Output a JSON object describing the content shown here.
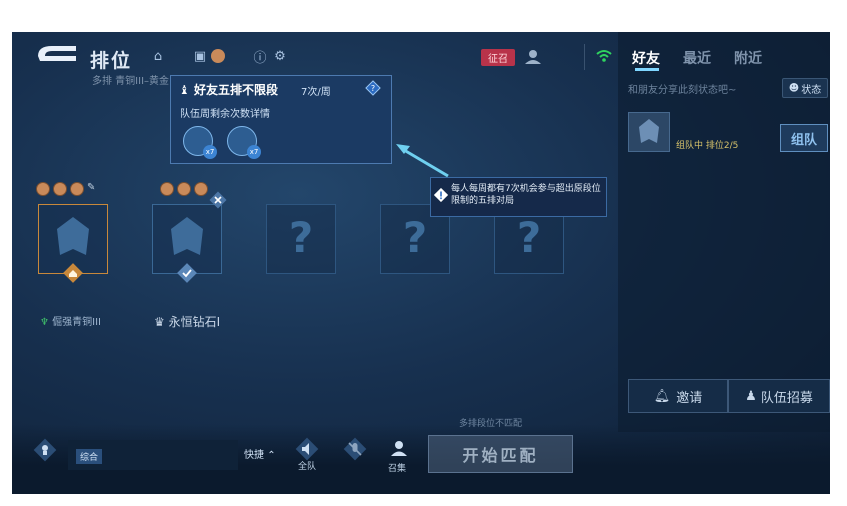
{
  "header": {
    "title": "排位",
    "subtitle": "多排 青铜III–黄金",
    "challenge_badge": "征召"
  },
  "right_panel": {
    "tabs": [
      {
        "label": "好友",
        "active": true
      },
      {
        "label": "最近",
        "active": false
      },
      {
        "label": "附近",
        "active": false
      }
    ],
    "share_status": "和朋友分享此刻状态吧~",
    "status_button": "状态",
    "friend_status": "组队中 排位2/5",
    "team_button": "组队",
    "invite_button": "邀请",
    "recruit_button": "队伍招募"
  },
  "popup": {
    "title": "好友五排不限段",
    "weekly": "7次/周",
    "subtitle": "队伍周剩余次数详情",
    "tokens": [
      {
        "count": "x7"
      },
      {
        "count": "x7"
      }
    ]
  },
  "hint": {
    "text": "每人每周都有7次机会参与超出原段位限制的五排对局"
  },
  "slots": [
    {
      "type": "player",
      "rank": "倔强青铜III"
    },
    {
      "type": "player",
      "rank": "永恒钻石I"
    },
    {
      "type": "empty",
      "mark": "?"
    },
    {
      "type": "empty",
      "mark": "?"
    },
    {
      "type": "empty",
      "mark": "?"
    }
  ],
  "bottom_bar": {
    "chat_tag": "综合",
    "quick_button": "快捷",
    "all_team_label": "全队",
    "summon_label": "召集",
    "mismatch_text": "多排段位不匹配",
    "start_button": "开始匹配"
  },
  "colors": {
    "background": "#17304f",
    "accent": "#7fd6ff",
    "leader_border": "#c8883b",
    "challenge_badge": "#b8334a"
  }
}
